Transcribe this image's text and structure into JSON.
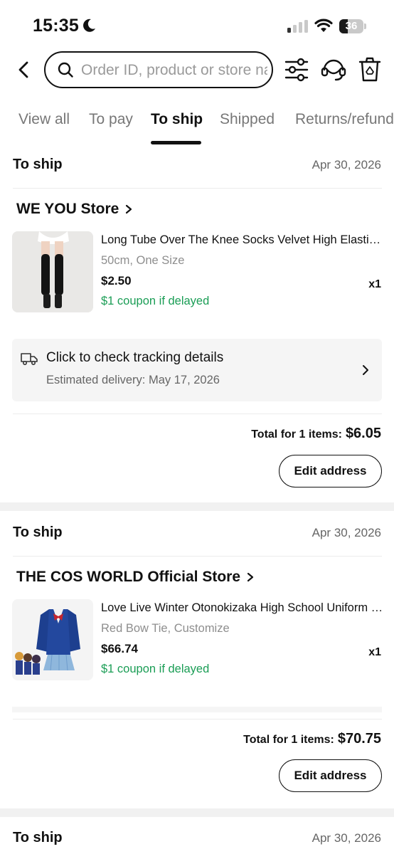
{
  "status_bar": {
    "time": "15:35",
    "battery": "36",
    "battery_level": 0.36
  },
  "search": {
    "placeholder": "Order ID, product or store name"
  },
  "tabs": [
    {
      "label": "View all"
    },
    {
      "label": "To pay"
    },
    {
      "label": "To ship",
      "active": true
    },
    {
      "label": "Shipped"
    },
    {
      "label": "Returns/refunds"
    }
  ],
  "orders": [
    {
      "status": "To ship",
      "date": "Apr 30, 2026",
      "store": "WE YOU Store",
      "product": {
        "title": "Long Tube Over The Knee Socks Velvet High Elastic Thigh High Stockings",
        "variant": "50cm, One Size",
        "price": "$2.50",
        "coupon": "$1 coupon if delayed",
        "qty": "x1"
      },
      "tracking": {
        "title": "Click to check tracking details",
        "eta": "Estimated delivery: May 17, 2026"
      },
      "total_label": "Total for 1 items:",
      "total_value": "$6.05",
      "action": "Edit address"
    },
    {
      "status": "To ship",
      "date": "Apr 30, 2026",
      "store": "THE COS WORLD Official Store",
      "product": {
        "title": "Love Live Winter Otonokizaka High School Uniform Cosplay Costume",
        "variant": "Red Bow Tie, Customize",
        "price": "$66.74",
        "coupon": "$1 coupon if delayed",
        "qty": "x1"
      },
      "total_label": "Total for 1 items:",
      "total_value": "$70.75",
      "action": "Edit address"
    },
    {
      "status": "To ship",
      "date": "Apr 30, 2026"
    }
  ],
  "colors": {
    "accent": "#111111",
    "coupon": "#1a9d55",
    "muted": "#777777"
  }
}
